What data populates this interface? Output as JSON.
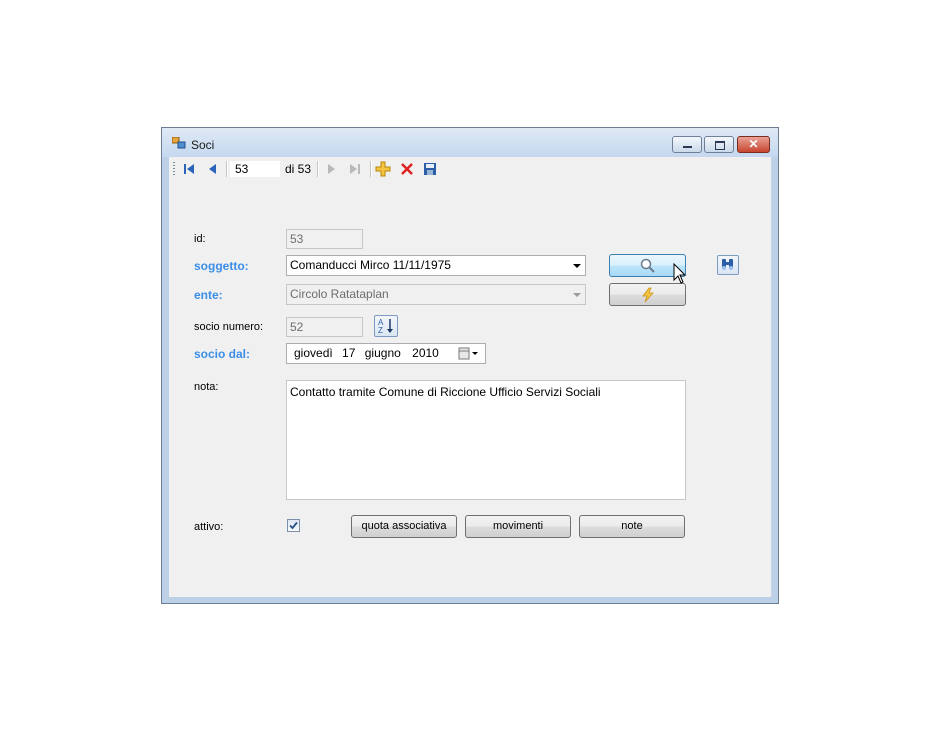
{
  "window": {
    "title": "Soci"
  },
  "toolbar": {
    "position_value": "53",
    "count_label": "di 53"
  },
  "form": {
    "id_label": "id:",
    "id_value": "53",
    "soggetto_label": "soggetto:",
    "soggetto_value": "Comanducci Mirco 11/11/1975",
    "ente_label": "ente:",
    "ente_value": "Circolo Ratataplan",
    "socio_numero_label": "socio numero:",
    "socio_numero_value": "52",
    "socio_dal_label": "socio dal:",
    "socio_dal": {
      "weekday": "giovedì",
      "day": "17",
      "month": "giugno",
      "year": "2010"
    },
    "nota_label": "nota:",
    "nota_value": "Contatto tramite Comune di Riccione Ufficio Servizi Sociali",
    "attivo_label": "attivo:",
    "attivo_checked": true
  },
  "buttons": {
    "quota": "quota associativa",
    "movimenti": "movimenti",
    "note": "note"
  },
  "colors": {
    "required_label": "#3b8ee8",
    "title_bar": "#c5d8ef"
  }
}
